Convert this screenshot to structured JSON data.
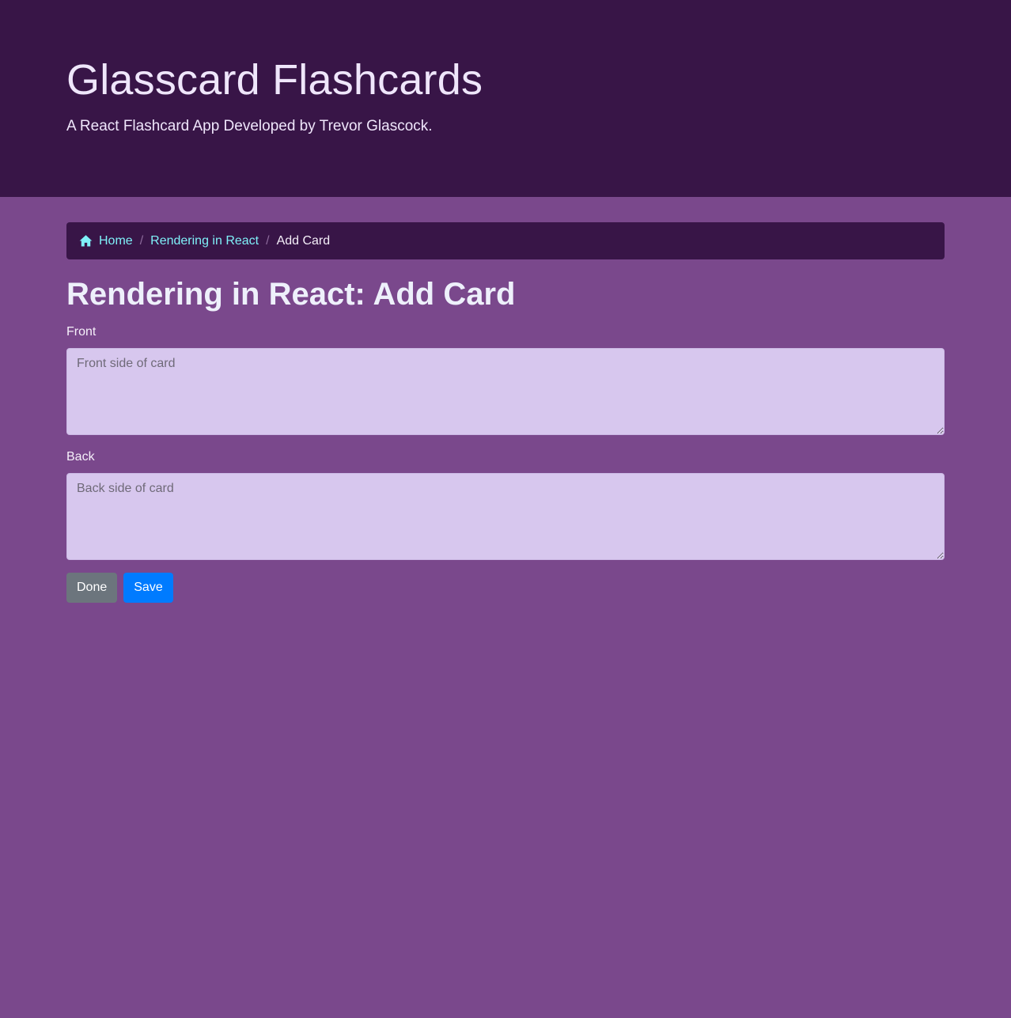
{
  "header": {
    "title": "Glasscard Flashcards",
    "subtitle": "A React Flashcard App Developed by Trevor Glascock."
  },
  "breadcrumb": {
    "home_icon": "home-icon",
    "home_label": "Home",
    "deck_label": "Rendering in React",
    "separator": "/",
    "current_label": "Add Card"
  },
  "main": {
    "heading": "Rendering in React: Add Card",
    "front": {
      "label": "Front",
      "value": "",
      "placeholder": "Front side of card"
    },
    "back": {
      "label": "Back",
      "value": "",
      "placeholder": "Back side of card"
    },
    "done_label": "Done",
    "save_label": "Save"
  },
  "colors": {
    "page_background": "#7a488c",
    "header_background": "#381547",
    "link": "#7ff0f8",
    "textarea_background": "#d7c7ee",
    "done_button": "#6c757d",
    "save_button": "#007bff"
  }
}
